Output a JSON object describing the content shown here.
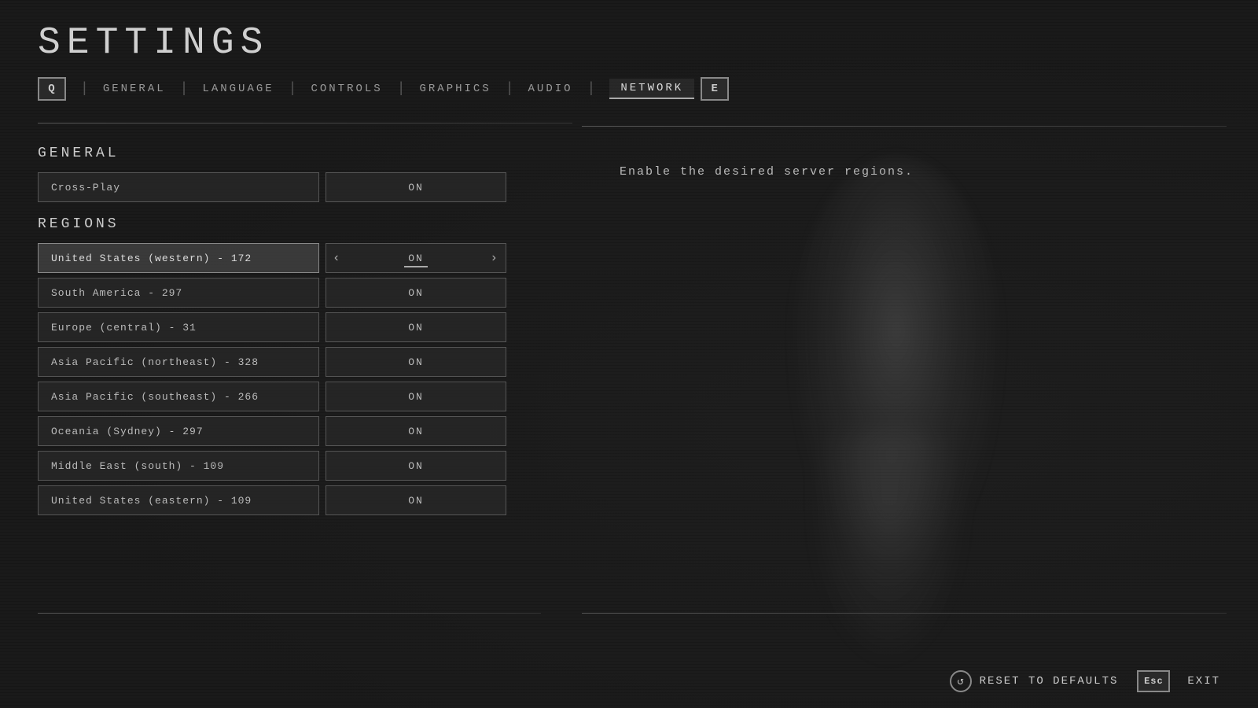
{
  "page": {
    "title": "SETTINGS"
  },
  "nav": {
    "left_key": "Q",
    "right_key": "E",
    "tabs": [
      {
        "id": "general",
        "label": "GENERAL",
        "active": false
      },
      {
        "id": "language",
        "label": "LANGUAGE",
        "active": false
      },
      {
        "id": "controls",
        "label": "CONTROLS",
        "active": false
      },
      {
        "id": "graphics",
        "label": "GRAPHICS",
        "active": false
      },
      {
        "id": "audio",
        "label": "AUDIO",
        "active": false
      },
      {
        "id": "network",
        "label": "NETWORK",
        "active": true
      }
    ]
  },
  "general_section": {
    "header": "GENERAL",
    "crossplay_label": "Cross-Play",
    "crossplay_value": "ON"
  },
  "regions_section": {
    "header": "REGIONS",
    "rows": [
      {
        "label": "United States (western) - 172",
        "value": "ON",
        "selected": true
      },
      {
        "label": "South America - 297",
        "value": "ON",
        "selected": false
      },
      {
        "label": "Europe (central) - 31",
        "value": "ON",
        "selected": false
      },
      {
        "label": "Asia Pacific (northeast) - 328",
        "value": "ON",
        "selected": false
      },
      {
        "label": "Asia Pacific (southeast) - 266",
        "value": "ON",
        "selected": false
      },
      {
        "label": "Oceania (Sydney) - 297",
        "value": "ON",
        "selected": false
      },
      {
        "label": "Middle East (south) - 109",
        "value": "ON",
        "selected": false
      },
      {
        "label": "United States (eastern) - 109",
        "value": "ON",
        "selected": false
      }
    ]
  },
  "description": {
    "text": "Enable the desired server regions."
  },
  "footer": {
    "reset_icon": "↺",
    "reset_label": "RESET TO DEFAULTS",
    "exit_key": "Esc",
    "exit_label": "EXIT"
  }
}
